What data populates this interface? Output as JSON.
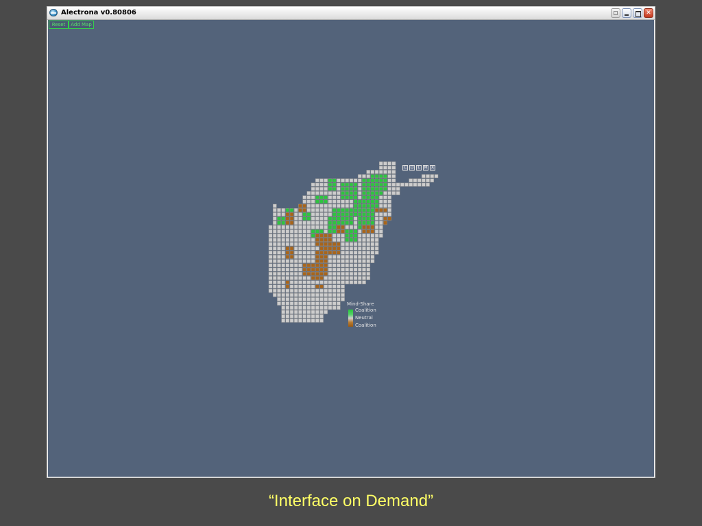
{
  "window": {
    "title": "Alectrona v0.80806",
    "controls": {
      "help": "",
      "minimize": "",
      "maximize": "",
      "close": "✕"
    }
  },
  "toolbar": {
    "reset_label": "Reset",
    "add_map_label": "Add Map"
  },
  "map": {
    "controls": [
      "C",
      "D",
      "L",
      "M",
      "X"
    ],
    "colors": {
      "empty": "#cdcdcd",
      "coalition": "#2dc43f",
      "opposition": "#a8651b",
      "canvas": "#53637a",
      "toolbar_accent": "#34d14a"
    }
  },
  "legend": {
    "title": "Mind-Share",
    "top_label": "Coalition",
    "mid_label": "Neutral",
    "bottom_label": "Coalition"
  },
  "caption": "“Interface on Demand”"
}
